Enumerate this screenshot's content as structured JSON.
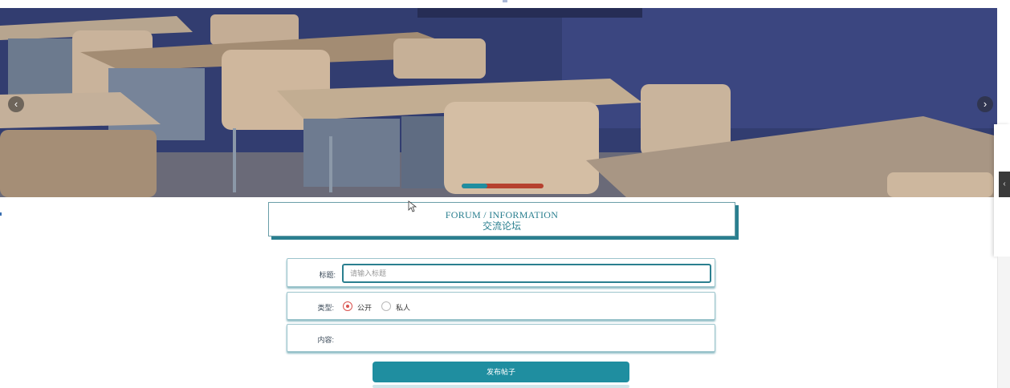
{
  "banner": {
    "prev_icon": "chevron-left-icon",
    "next_icon": "chevron-right-icon",
    "prev_glyph": "‹",
    "next_glyph": "›",
    "slide_index": 1,
    "slide_count": 3
  },
  "section": {
    "title_en": "FORUM / INFORMATION",
    "title_cn": "交流论坛"
  },
  "form": {
    "title_label": "标题:",
    "title_placeholder": "请输入标题",
    "title_value": "",
    "type_label": "类型:",
    "type_options": [
      {
        "label": "公开",
        "checked": true
      },
      {
        "label": "私人",
        "checked": false
      }
    ],
    "content_label": "内容:",
    "submit_label": "发布帖子"
  },
  "side": {
    "toggle_icon": "chevron-left-icon",
    "toggle_glyph": "‹"
  },
  "colors": {
    "accent": "#1f8ea0",
    "title_text": "#2a7f8f",
    "radio_checked": "#d9534f"
  }
}
